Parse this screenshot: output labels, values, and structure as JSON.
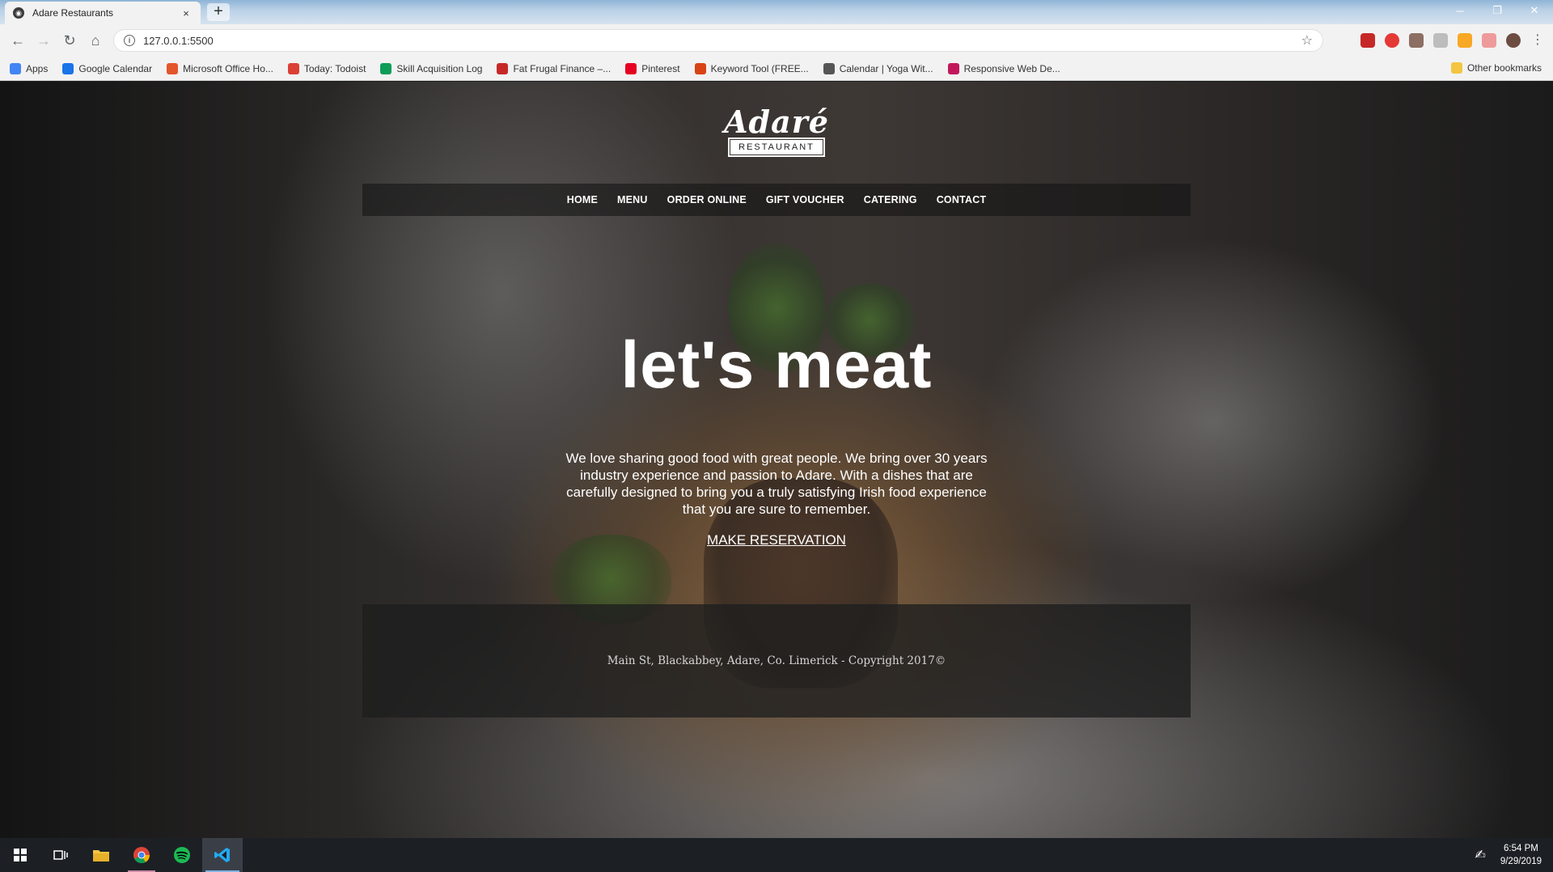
{
  "browser": {
    "tab_title": "Adare Restaurants",
    "tab_close": "×",
    "new_tab": "+",
    "url": "127.0.0.1:5500",
    "window_controls": [
      "─",
      "❐",
      "✕"
    ],
    "bookmarks": [
      {
        "label": "Apps",
        "color": "#4285f4"
      },
      {
        "label": "Google Calendar",
        "color": "#1a73e8"
      },
      {
        "label": "Microsoft Office Ho...",
        "color": "#e3552b"
      },
      {
        "label": "Today: Todoist",
        "color": "#db4035"
      },
      {
        "label": "Skill Acquisition Log",
        "color": "#0f9d58"
      },
      {
        "label": "Fat Frugal Finance –...",
        "color": "#c62828"
      },
      {
        "label": "Pinterest",
        "color": "#e60023"
      },
      {
        "label": "Keyword Tool (FREE...",
        "color": "#d84315"
      },
      {
        "label": "Calendar | Yoga Wit...",
        "color": "#555555"
      },
      {
        "label": "Responsive Web De...",
        "color": "#c2185b"
      }
    ],
    "other_bookmarks": "Other bookmarks"
  },
  "site": {
    "logo_script": "Adaré",
    "logo_badge": "RESTAURANT",
    "nav": [
      "HOME",
      "MENU",
      "ORDER ONLINE",
      "GIFT VOUCHER",
      "CATERING",
      "CONTACT"
    ],
    "hero_title": "let's meat",
    "hero_text": "We love sharing good food with great people. We bring over 30 years industry experience and passion to Adare. With a dishes that are carefully designed to bring you a truly satisfying Irish food experience that you are sure to remember.",
    "cta": "MAKE RESERVATION",
    "footer": "Main St, Blackabbey, Adare, Co. Limerick - Copyright 2017©"
  },
  "taskbar": {
    "time": "6:54 PM",
    "date": "9/29/2019"
  }
}
